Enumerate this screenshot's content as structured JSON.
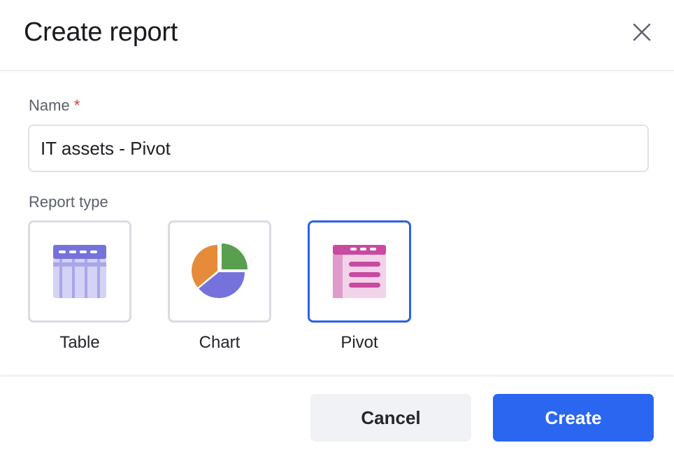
{
  "dialog": {
    "title": "Create report"
  },
  "form": {
    "name_label": "Name",
    "required_marker": "*",
    "name_value": "IT assets - Pivot",
    "report_type_label": "Report type",
    "report_types": [
      {
        "label": "Table",
        "icon": "table-icon",
        "selected": false
      },
      {
        "label": "Chart",
        "icon": "pie-chart-icon",
        "selected": false
      },
      {
        "label": "Pivot",
        "icon": "pivot-icon",
        "selected": true
      }
    ]
  },
  "footer": {
    "cancel_label": "Cancel",
    "create_label": "Create"
  },
  "colors": {
    "accent": "#2a66f0",
    "selected_border": "#2962e8",
    "required": "#d23b3b",
    "table_icon": "#7672dc",
    "chart_orange": "#e58b3a",
    "chart_green": "#5a9e4f",
    "chart_purple": "#7672dc",
    "pivot_icon": "#c94aa0"
  }
}
